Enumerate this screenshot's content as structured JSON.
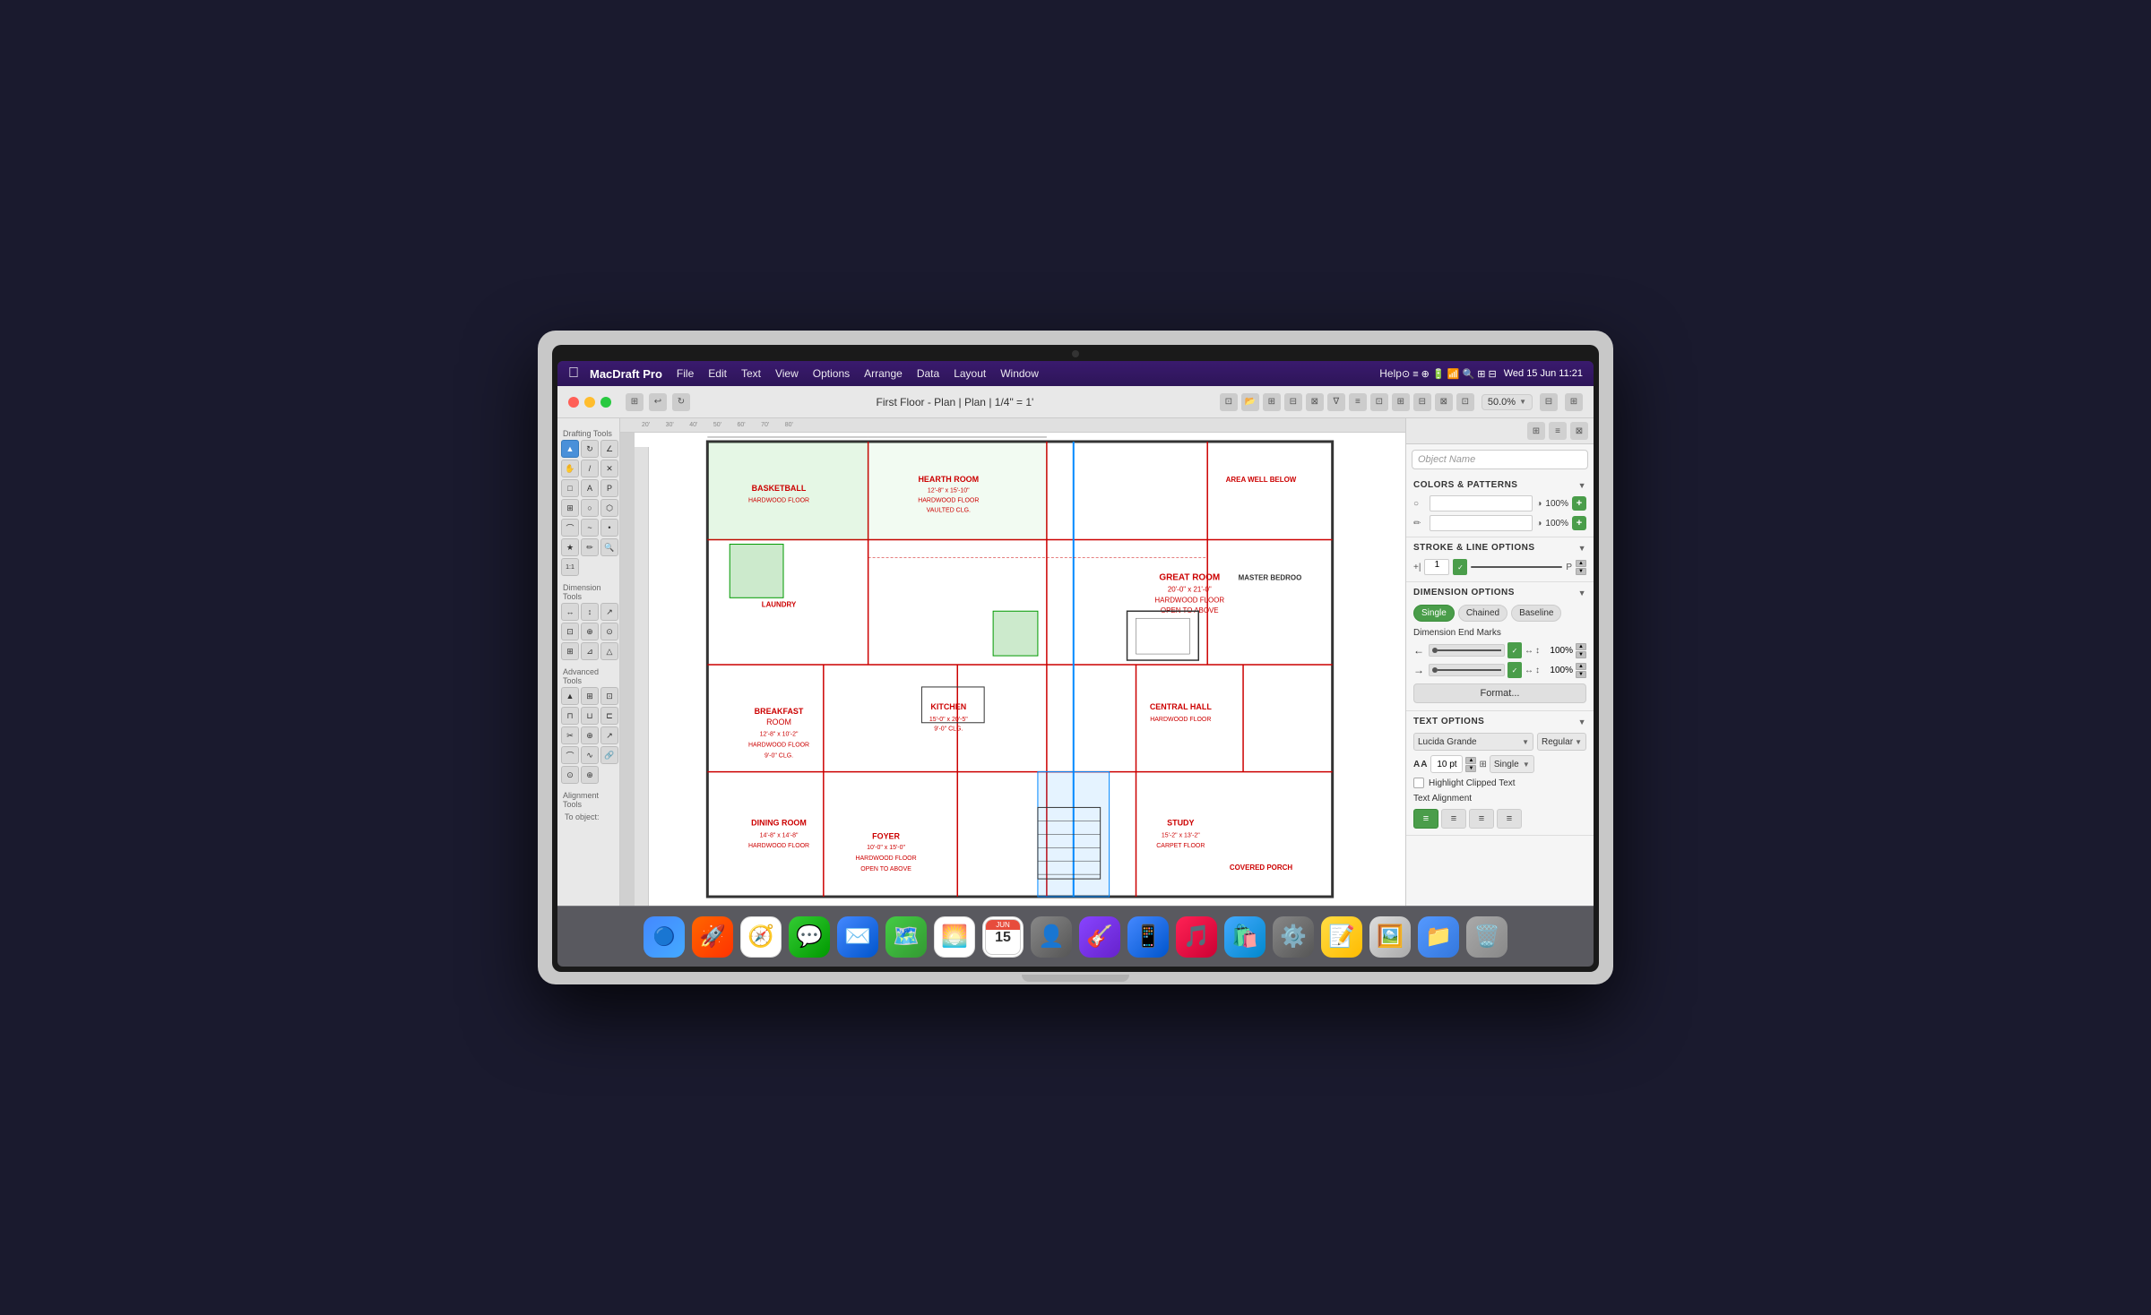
{
  "os": {
    "menubar": {
      "apple_icon": "🍎",
      "app_name": "MacDraft Pro",
      "menus": [
        "File",
        "Edit",
        "Text",
        "View",
        "Options",
        "Arrange",
        "Data",
        "Layout",
        "Window"
      ],
      "help": "Help",
      "date_time": "Wed 15 Jun  11:21",
      "battery_icon": "🔋",
      "wifi_icon": "📶"
    },
    "dock": {
      "items": [
        {
          "name": "finder",
          "icon": "🔵",
          "label": "Finder"
        },
        {
          "name": "launchpad",
          "icon": "🚀",
          "label": "Launchpad"
        },
        {
          "name": "safari",
          "icon": "🧭",
          "label": "Safari"
        },
        {
          "name": "messages",
          "icon": "💬",
          "label": "Messages"
        },
        {
          "name": "mail",
          "icon": "✉️",
          "label": "Mail"
        },
        {
          "name": "maps",
          "icon": "🗺️",
          "label": "Maps"
        },
        {
          "name": "photos",
          "icon": "🌅",
          "label": "Photos"
        },
        {
          "name": "calendar",
          "icon": "📅",
          "label": "Calendar"
        },
        {
          "name": "contacts",
          "icon": "👤",
          "label": "Contacts"
        },
        {
          "name": "instruments",
          "icon": "🎸",
          "label": "Instruments"
        },
        {
          "name": "appstore",
          "icon": "📱",
          "label": "App Store"
        },
        {
          "name": "music",
          "icon": "🎵",
          "label": "Music"
        },
        {
          "name": "appstore2",
          "icon": "🛍️",
          "label": "App Store"
        },
        {
          "name": "settings",
          "icon": "⚙️",
          "label": "System Settings"
        },
        {
          "name": "notes",
          "icon": "📝",
          "label": "Notes"
        },
        {
          "name": "preview",
          "icon": "🖼️",
          "label": "Preview"
        },
        {
          "name": "folder",
          "icon": "📁",
          "label": "Folder"
        },
        {
          "name": "trash",
          "icon": "🗑️",
          "label": "Trash"
        }
      ]
    }
  },
  "window": {
    "title": "First Floor - Plan | Plan | 1/4\" = 1'",
    "zoom": "50.0%",
    "traffic_lights": {
      "close": "#ff5f57",
      "minimize": "#ffbd2e",
      "maximize": "#28c940"
    }
  },
  "left_toolbar": {
    "sections": [
      {
        "label": "Drafting Tools",
        "tools": [
          {
            "id": "select",
            "icon": "▲",
            "active": true
          },
          {
            "id": "rotate",
            "icon": "↻"
          },
          {
            "id": "angle",
            "icon": "∠"
          },
          {
            "id": "hand",
            "icon": "✋"
          },
          {
            "id": "line",
            "icon": "/"
          },
          {
            "id": "xline",
            "icon": "✕"
          },
          {
            "id": "rect",
            "icon": "□"
          },
          {
            "id": "text",
            "icon": "A"
          },
          {
            "id": "pencil",
            "icon": "P"
          },
          {
            "id": "dim",
            "icon": "⊞"
          },
          {
            "id": "circle",
            "icon": "○"
          },
          {
            "id": "poly",
            "icon": "⬡"
          },
          {
            "id": "arc",
            "icon": "⌒"
          },
          {
            "id": "wave",
            "icon": "~"
          },
          {
            "id": "node",
            "icon": "•"
          },
          {
            "id": "star",
            "icon": "★"
          },
          {
            "id": "pen",
            "icon": "✏️"
          },
          {
            "id": "zoom",
            "icon": "🔍"
          },
          {
            "id": "realscale",
            "icon": "1:1"
          }
        ]
      },
      {
        "label": "Dimension Tools",
        "tools": [
          {
            "id": "dim1",
            "icon": "↔"
          },
          {
            "id": "dim2",
            "icon": "↕"
          },
          {
            "id": "dim3",
            "icon": "↗"
          },
          {
            "id": "dim4",
            "icon": "⊡"
          },
          {
            "id": "dim5",
            "icon": "⊕"
          },
          {
            "id": "dim6",
            "icon": "⊙"
          },
          {
            "id": "dim7",
            "icon": "⊞"
          },
          {
            "id": "dim8",
            "icon": "⊿"
          },
          {
            "id": "dim9",
            "icon": "△"
          }
        ]
      },
      {
        "label": "Advanced Tools",
        "tools": [
          {
            "id": "adv1",
            "icon": "▲"
          },
          {
            "id": "adv2",
            "icon": "⊞"
          },
          {
            "id": "adv3",
            "icon": "⊡"
          },
          {
            "id": "adv4",
            "icon": "⊓"
          },
          {
            "id": "adv5",
            "icon": "⊔"
          },
          {
            "id": "adv6",
            "icon": "⊏"
          },
          {
            "id": "adv7",
            "icon": "✂"
          },
          {
            "id": "adv8",
            "icon": "⊕"
          },
          {
            "id": "adv9",
            "icon": "↗"
          },
          {
            "id": "adv10",
            "icon": "⌒"
          },
          {
            "id": "adv11",
            "icon": "∿"
          },
          {
            "id": "adv12",
            "icon": "🔗"
          },
          {
            "id": "adv13",
            "icon": "⊙"
          },
          {
            "id": "adv14",
            "icon": "⊕"
          }
        ]
      }
    ],
    "alignment_label": "Alignment Tools",
    "to_object_label": "To object:"
  },
  "right_panel": {
    "object_name_placeholder": "Object Name",
    "sections": {
      "colors_patterns": {
        "label": "COLORS & PATTERNS",
        "fill_color": "#ffffff",
        "fill_opacity": "100%",
        "stroke_color": "#ffffff",
        "stroke_opacity": "100%"
      },
      "stroke_line": {
        "label": "STROKE & LINE OPTIONS",
        "width": "1",
        "dash_pattern": "P"
      },
      "dimension": {
        "label": "DIMENSION OPTIONS",
        "modes": [
          "Single",
          "Chained",
          "Baseline"
        ],
        "active_mode": "Single",
        "end_marks_label": "Dimension End Marks",
        "end_mark1_pct": "100%",
        "end_mark2_pct": "100%",
        "format_btn": "Format..."
      },
      "text_options": {
        "label": "TEXT OPTIONS",
        "font": "Lucida Grande",
        "style": "Regular",
        "size": "10 pt",
        "spacing_mode": "Single",
        "highlight_label": "Highlight Clipped Text",
        "alignment_label": "Text Alignment",
        "alignments": [
          "left",
          "center",
          "right",
          "justify"
        ]
      }
    }
  }
}
